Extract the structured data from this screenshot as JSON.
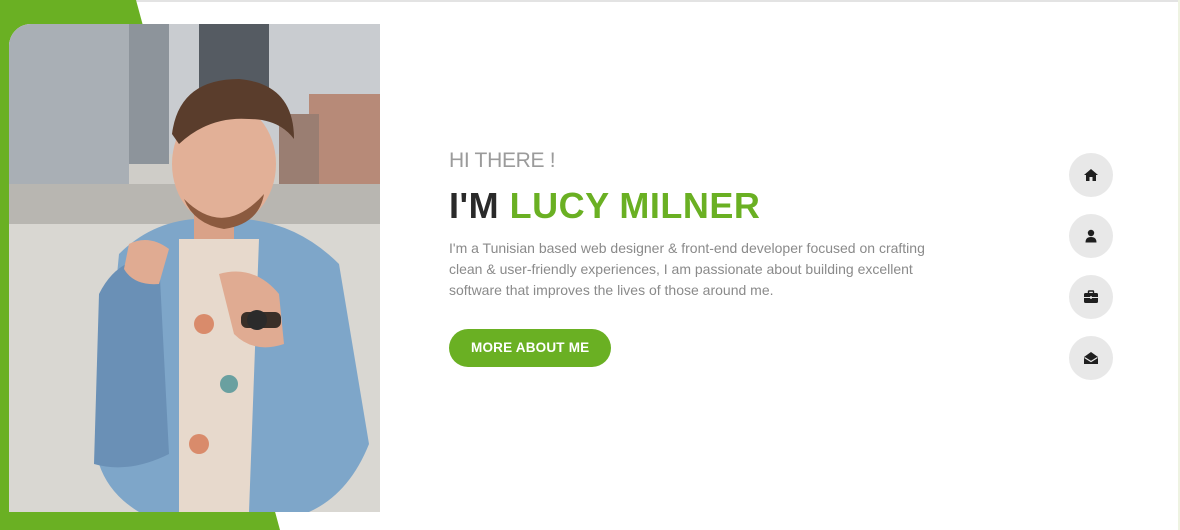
{
  "hero": {
    "greeting": "HI THERE !",
    "name_prefix": "I'M",
    "name_highlight": "LUCY MILNER",
    "bio": "I'm a Tunisian based web designer & front-end developer focused on crafting clean & user-friendly experiences, I am passionate about building excellent software that improves the lives of those around me.",
    "cta_label": "MORE ABOUT ME",
    "photo_alt": "Portrait photo"
  },
  "nav": {
    "items": [
      {
        "icon": "home-icon"
      },
      {
        "icon": "user-icon"
      },
      {
        "icon": "briefcase-icon"
      },
      {
        "icon": "envelope-open-icon"
      }
    ]
  },
  "colors": {
    "accent": "#6ab023",
    "heading_dark": "#2a2a2a",
    "muted_text": "#8a8a8a",
    "nav_bg": "#e8e8e8"
  }
}
